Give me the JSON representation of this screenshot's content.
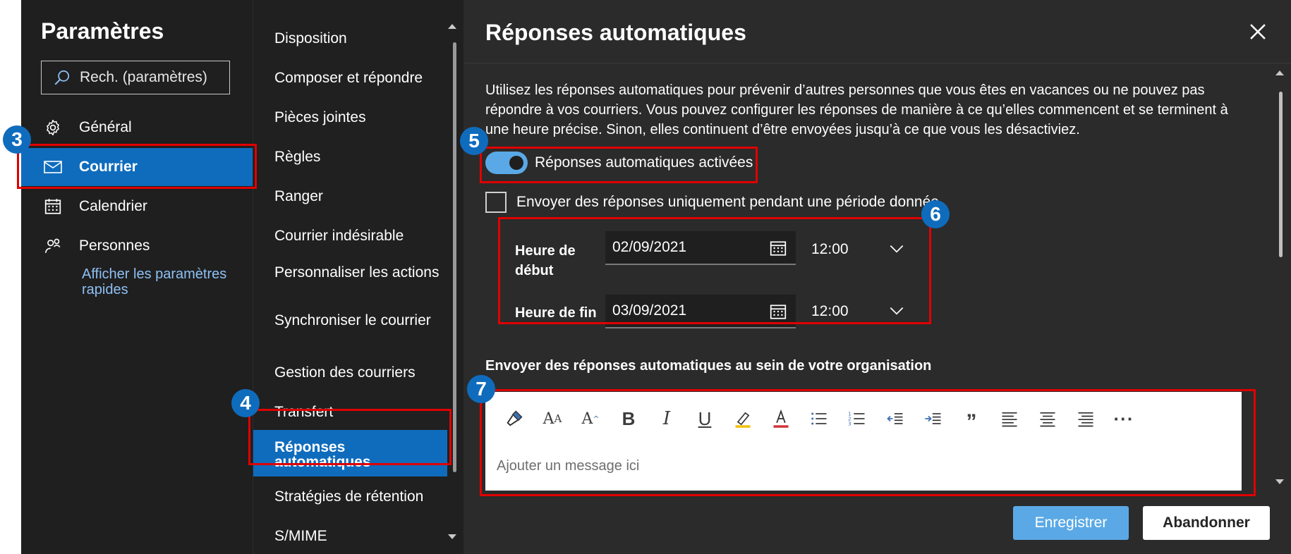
{
  "left_nav": {
    "title": "Paramètres",
    "search_placeholder": "Rech. (paramètres)",
    "items": [
      {
        "label": "Général",
        "icon": "gear-icon"
      },
      {
        "label": "Courrier",
        "icon": "mail-icon",
        "active": true
      },
      {
        "label": "Calendrier",
        "icon": "calendar-icon"
      },
      {
        "label": "Personnes",
        "icon": "people-icon"
      }
    ],
    "quick_settings_link": "Afficher les paramètres rapides"
  },
  "mail_menu": {
    "items": [
      "Disposition",
      "Composer et répondre",
      "Pièces jointes",
      "Règles",
      "Ranger",
      "Courrier indésirable",
      "Personnaliser les actions",
      "Synchroniser le courrier",
      "Gestion des courriers",
      "Transfert",
      "Réponses automatiques",
      "Stratégies de rétention",
      "S/MIME"
    ],
    "active_index": 10
  },
  "panel": {
    "title": "Réponses automatiques",
    "description": "Utilisez les réponses automatiques pour prévenir d’autres personnes que vous êtes en vacances ou ne pouvez pas répondre à vos courriers. Vous pouvez configurer les réponses de manière à ce qu’elles commencent et se terminent à une heure précise. Sinon, elles continuent d’être envoyées jusqu’à ce que vous les désactiviez.",
    "toggle_label": "Réponses automatiques activées",
    "toggle_on": true,
    "period_checkbox_label": "Envoyer des réponses uniquement pendant une période donnée",
    "period_checked": false,
    "start": {
      "label": "Heure de début",
      "date": "02/09/2021",
      "time": "12:00"
    },
    "end": {
      "label": "Heure de fin",
      "date": "03/09/2021",
      "time": "12:00"
    },
    "org_heading": "Envoyer des réponses automatiques au sein de votre organisation",
    "editor_placeholder": "Ajouter un message ici",
    "toolbar": [
      "format-painter-icon",
      "font-size-icon",
      "grow-font-icon",
      "bold-icon",
      "italic-icon",
      "underline-icon",
      "highlight-icon",
      "font-color-icon",
      "bullets-icon",
      "numbering-icon",
      "decrease-indent-icon",
      "increase-indent-icon",
      "quote-icon",
      "align-left-icon",
      "align-center-icon",
      "align-right-icon",
      "more-icon"
    ],
    "save_label": "Enregistrer",
    "cancel_label": "Abandonner"
  },
  "annotations": [
    "3",
    "4",
    "5",
    "6",
    "7"
  ],
  "colors": {
    "accent": "#0f6cbd",
    "toggle": "#5aa9e6",
    "highlight_border": "#e00000",
    "dark_bg": "#1f1f1f",
    "panel_bg": "#2b2b2b"
  }
}
